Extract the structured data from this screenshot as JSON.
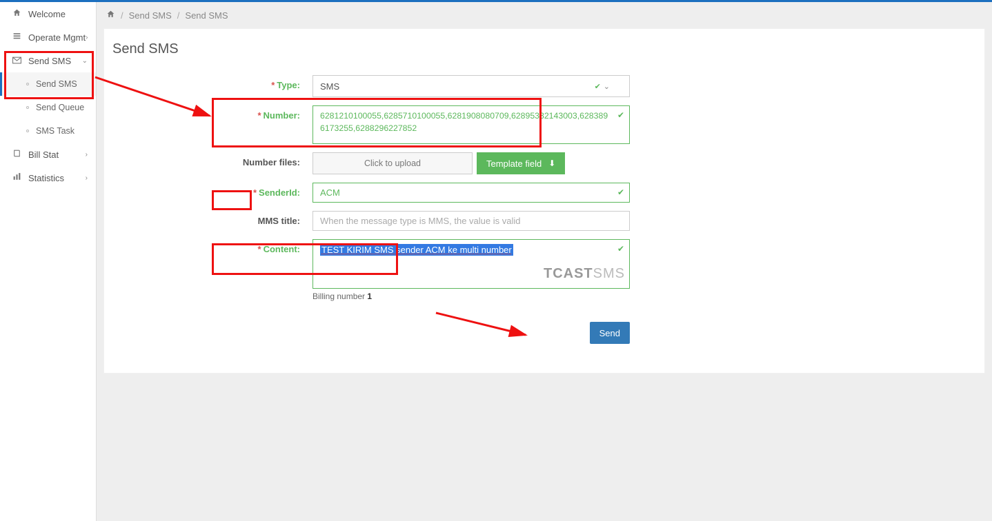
{
  "breadcrumb": {
    "root_icon": "home",
    "items": [
      "Send SMS",
      "Send SMS"
    ]
  },
  "sidebar": {
    "items": [
      {
        "id": "welcome",
        "label": "Welcome",
        "icon": "home",
        "expandable": false
      },
      {
        "id": "operate",
        "label": "Operate Mgmt",
        "icon": "list",
        "expandable": true
      },
      {
        "id": "sendsms",
        "label": "Send SMS",
        "icon": "mail",
        "expandable": true,
        "expanded": true,
        "highlighted": true,
        "children": [
          {
            "id": "sendsms-sub",
            "label": "Send SMS",
            "active": true
          },
          {
            "id": "sendqueue",
            "label": "Send Queue"
          },
          {
            "id": "smstask",
            "label": "SMS Task"
          }
        ]
      },
      {
        "id": "billstat",
        "label": "Bill Stat",
        "icon": "book",
        "expandable": true
      },
      {
        "id": "statistics",
        "label": "Statistics",
        "icon": "chart",
        "expandable": true
      }
    ]
  },
  "panel": {
    "title": "Send SMS"
  },
  "form": {
    "type_label": "Type:",
    "type_value": "SMS",
    "number_label": "Number:",
    "number_value": "6281210100055,6285710100055,6281908080709,62895332143003,6283896173255,6288296227852",
    "numberfiles_label": "Number files:",
    "upload_label": "Click to upload",
    "template_label": "Template field",
    "senderid_label": "SenderId:",
    "senderid_value": "ACM",
    "mmstitle_label": "MMS title:",
    "mmstitle_placeholder": "When the message type is MMS, the value is valid",
    "content_label": "Content:",
    "content_value": "TEST KIRIM SMS sender ACM ke multi number",
    "billing_prefix": "Billing number ",
    "billing_value": "1",
    "send_label": "Send"
  },
  "watermark": {
    "a": "TCAST",
    "b": "SMS"
  },
  "colors": {
    "accent": "#1c6fbf",
    "success": "#5cb85c",
    "primary_btn": "#337ab7",
    "annot": "#e11"
  }
}
